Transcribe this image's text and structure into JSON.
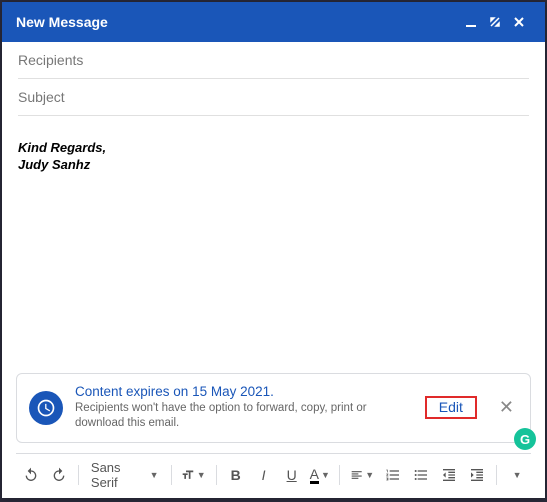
{
  "header": {
    "title": "New Message"
  },
  "fields": {
    "recipients_placeholder": "Recipients",
    "subject_placeholder": "Subject"
  },
  "body": {
    "signature_line1": "Kind Regards,",
    "signature_line2": "Judy Sanhz"
  },
  "confidential": {
    "title": "Content expires on 15 May 2021.",
    "subtitle": "Recipients won't have the option to forward, copy, print or download this email.",
    "edit_label": "Edit"
  },
  "toolbar": {
    "font": "Sans Serif"
  }
}
